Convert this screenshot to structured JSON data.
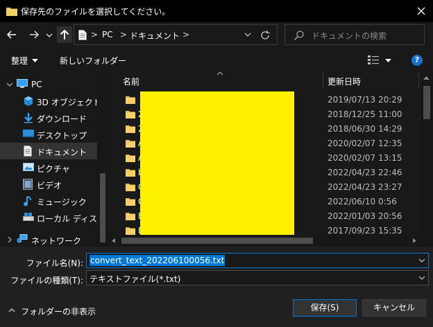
{
  "window": {
    "title": "保存先のファイルを選択してください。",
    "close_glyph": "✕"
  },
  "address": {
    "crumbs": [
      "PC",
      "ドキュメント"
    ],
    "separator": ">"
  },
  "search": {
    "placeholder": "ドキュメントの検索"
  },
  "toolbar": {
    "organize": "整理",
    "new_folder": "新しいフォルダー",
    "help": "?"
  },
  "nav": {
    "items": [
      {
        "label": "PC",
        "icon": "pc-icon"
      },
      {
        "label": "3D オブジェクト",
        "icon": "3d-objects-icon"
      },
      {
        "label": "ダウンロード",
        "icon": "download-icon"
      },
      {
        "label": "デスクトップ",
        "icon": "desktop-icon"
      },
      {
        "label": "ドキュメント",
        "icon": "document-icon",
        "selected": true
      },
      {
        "label": "ピクチャ",
        "icon": "pictures-icon"
      },
      {
        "label": "ビデオ",
        "icon": "video-icon"
      },
      {
        "label": "ミュージック",
        "icon": "music-icon"
      },
      {
        "label": "ローカル ディスク (C",
        "icon": "local-disk-icon"
      },
      {
        "label": "ネットワーク",
        "icon": "network-icon"
      }
    ]
  },
  "columns": {
    "name": "名前",
    "date": "更新日時"
  },
  "files": [
    {
      "name": "",
      "date": "2019/07/13 20:29"
    },
    {
      "name": "2",
      "date": "2018/12/25 11:00"
    },
    {
      "name": "2",
      "date": "2018/06/30 14:29"
    },
    {
      "name": "A",
      "date": "2020/02/07 12:35"
    },
    {
      "name": "A",
      "date": "2020/02/07 13:15"
    },
    {
      "name": "b",
      "date": "2022/04/23 22:46"
    },
    {
      "name": "C",
      "date": "2022/04/23 23:27"
    },
    {
      "name": "C",
      "date": "2022/06/10 0:56"
    },
    {
      "name": "E",
      "date": "2022/01/03 20:56"
    },
    {
      "name": "E",
      "date": "2017/09/23 15:35"
    }
  ],
  "bottom": {
    "filename_label": "ファイル名(N):",
    "filename_value": "convert_text_202206100056.txt",
    "filetype_label": "ファイルの種類(T):",
    "filetype_value": "テキストファイル(*.txt)",
    "hide_folders": "フォルダーの非表示",
    "save": "保存(S)",
    "cancel": "キャンセル"
  },
  "colors": {
    "accent": "#0078d7",
    "folder": "#e8b84a",
    "redaction": "#fff200"
  }
}
